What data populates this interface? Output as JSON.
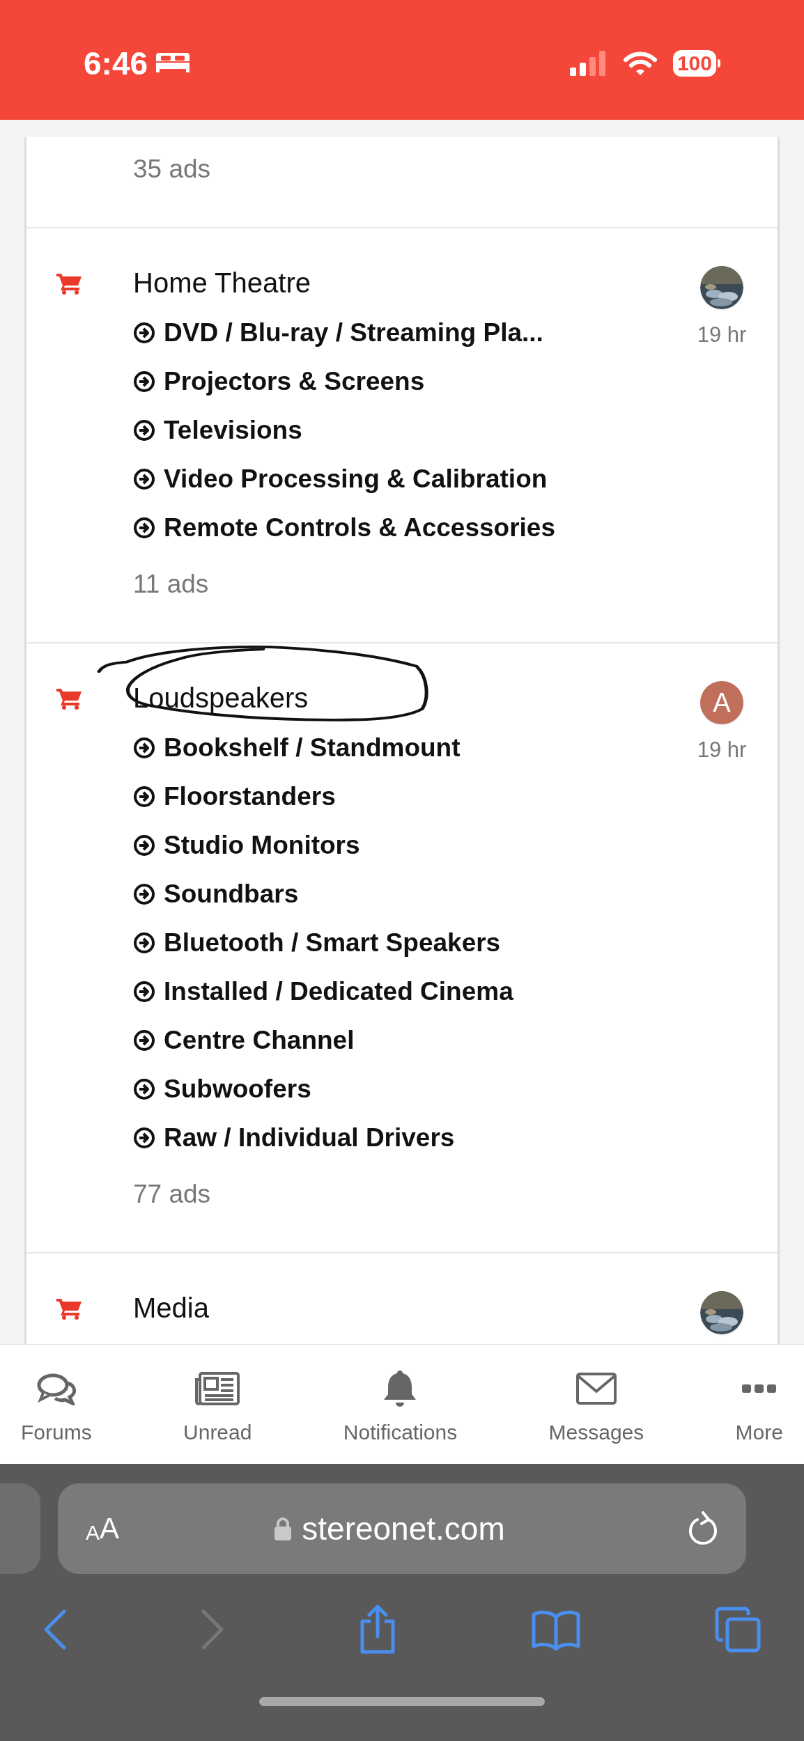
{
  "status_bar": {
    "time": "6:46",
    "battery": "100"
  },
  "categories": [
    {
      "ad_count": "35 ads",
      "annotated": false
    },
    {
      "title": "Home Theatre",
      "time": "19 hr",
      "subcategories": [
        "DVD / Blu-ray / Streaming Pla...",
        "Projectors & Screens",
        "Televisions",
        "Video Processing & Calibration",
        "Remote Controls & Accessories"
      ],
      "ad_count": "11 ads",
      "annotated": false
    },
    {
      "title": "Loudspeakers",
      "avatar": {
        "kind": "letter",
        "letter": "A"
      },
      "time": "19 hr",
      "subcategories": [
        "Bookshelf / Standmount",
        "Floorstanders",
        "Studio Monitors",
        "Soundbars",
        "Bluetooth / Smart Speakers",
        "Installed / Dedicated Cinema",
        "Centre Channel",
        "Subwoofers",
        "Raw / Individual Drivers"
      ],
      "ad_count": "77 ads",
      "annotated": true
    },
    {
      "title": "Media",
      "annotated": false
    }
  ],
  "tab_bar": [
    {
      "label": "Forums"
    },
    {
      "label": "Unread"
    },
    {
      "label": "Notifications"
    },
    {
      "label": "Messages"
    },
    {
      "label": "More"
    }
  ],
  "browser": {
    "text_size_button": "AA",
    "url": "stereonet.com"
  }
}
